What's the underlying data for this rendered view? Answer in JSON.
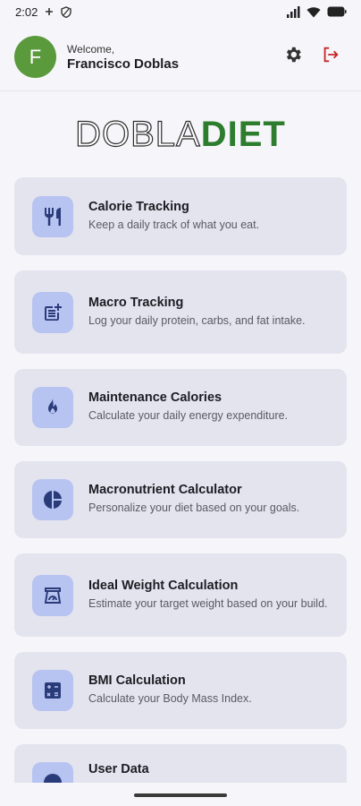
{
  "status_bar": {
    "time": "2:02",
    "icons": [
      "plus-icon",
      "shield-icon",
      "signal-icon",
      "wifi-icon",
      "battery-icon"
    ]
  },
  "header": {
    "avatar_letter": "F",
    "welcome": "Welcome,",
    "user_name": "Francisco Doblas",
    "icons": [
      "settings-icon",
      "logout-icon"
    ]
  },
  "logo": {
    "part1": "DOBLA",
    "part2": "DIET"
  },
  "colors": {
    "accent": "#b7c3f0",
    "brand_green": "#2e7d2e",
    "avatar": "#5a9a3c",
    "logout_red": "#c62828"
  },
  "cards": [
    {
      "title": "Calorie Tracking",
      "desc": "Keep a daily track of what you eat.",
      "icon": "utensils-icon"
    },
    {
      "title": "Macro Tracking",
      "desc": "Log your daily protein, carbs, and fat intake.",
      "icon": "post-add-icon"
    },
    {
      "title": "Maintenance Calories",
      "desc": "Calculate your daily energy expenditure.",
      "icon": "flame-icon"
    },
    {
      "title": "Macronutrient Calculator",
      "desc": "Personalize your diet based on your goals.",
      "icon": "pie-chart-icon"
    },
    {
      "title": "Ideal Weight Calculation",
      "desc": "Estimate your target weight based on your build.",
      "icon": "scale-icon"
    },
    {
      "title": "BMI Calculation",
      "desc": "Calculate your Body Mass Index.",
      "icon": "calculator-icon"
    },
    {
      "title": "User Data",
      "desc": "",
      "icon": "user-icon"
    }
  ]
}
